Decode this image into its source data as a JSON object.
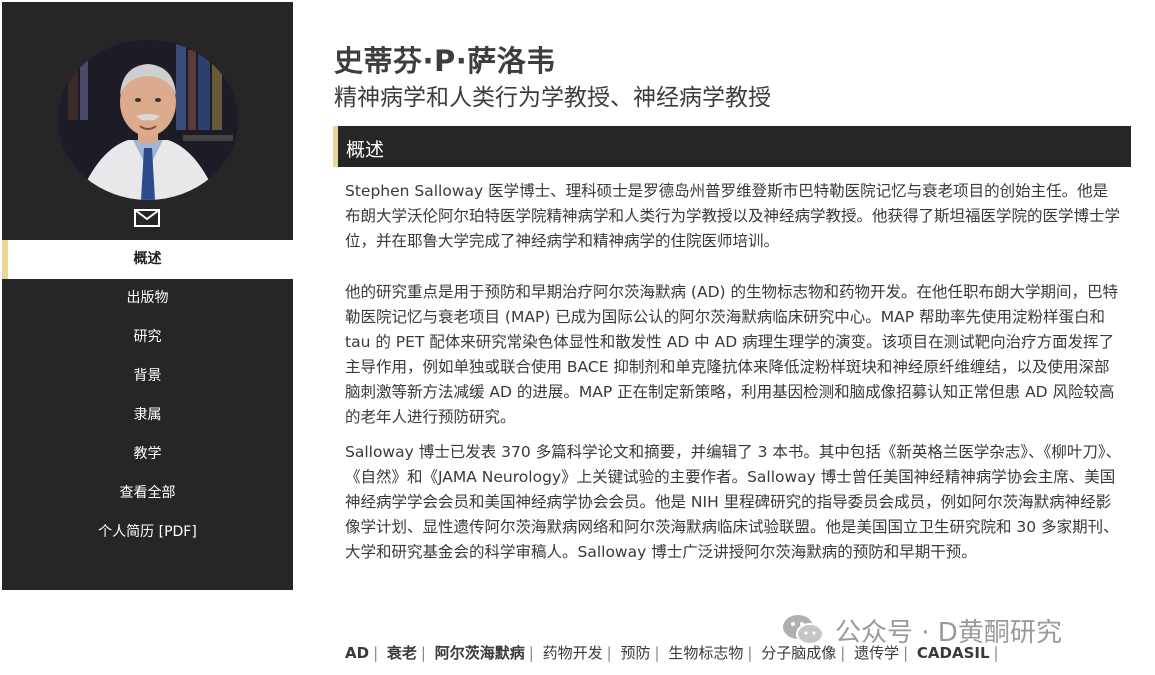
{
  "profile": {
    "name": "史蒂芬·P·萨洛韦",
    "title": "精神病学和人类行为学教授、神经病学教授"
  },
  "sidebar": {
    "items": [
      {
        "label": "概述"
      },
      {
        "label": "出版物"
      },
      {
        "label": "研究"
      },
      {
        "label": "背景"
      },
      {
        "label": "隶属"
      },
      {
        "label": "教学"
      },
      {
        "label": "查看全部"
      },
      {
        "label": "个人简历 [PDF]"
      }
    ]
  },
  "overview": {
    "heading": "概述",
    "paragraphs": [
      "Stephen Salloway 医学博士、理科硕士是罗德岛州普罗维登斯市巴特勒医院记忆与衰老项目的创始主任。他是布朗大学沃伦阿尔珀特医学院精神病学和人类行为学教授以及神经病学教授。他获得了斯坦福医学院的医学博士学位，并在耶鲁大学完成了神经病学和精神病学的住院医师培训。",
      "他的研究重点是用于预防和早期治疗阿尔茨海默病 (AD) 的生物标志物和药物开发。在他任职布朗大学期间，巴特勒医院记忆与衰老项目 (MAP) 已成为国际公认的阿尔茨海默病临床研究中心。MAP 帮助率先使用淀粉样蛋白和 tau 的 PET 配体来研究常染色体显性和散发性 AD 中 AD 病理生理学的演变。该项目在测试靶向治疗方面发挥了主导作用，例如单独或联合使用 BACE 抑制剂和单克隆抗体来降低淀粉样斑块和神经原纤维缠结，以及使用深部脑刺激等新方法减缓 AD 的进展。MAP 正在制定新策略，利用基因检测和脑成像招募认知正常但患 AD 风险较高的老年人进行预防研究。",
      "Salloway 博士已发表 370 多篇科学论文和摘要，并编辑了 3 本书。其中包括《新英格兰医学杂志》、《柳叶刀》、《自然》和《JAMA Neurology》上关键试验的主要作者。Salloway 博士曾任美国神经精神病学协会主席、美国神经病学学会会员和美国神经病学协会会员。他是 NIH 里程碑研究的指导委员会成员，例如阿尔茨海默病神经影像学计划、显性遗传阿尔茨海默病网络和阿尔茨海默病临床试验联盟。他是美国国立卫生研究院和 30 多家期刊、大学和研究基金会的科学审稿人。Salloway 博士广泛讲授阿尔茨海默病的预防和早期干预。"
    ]
  },
  "tags": [
    {
      "label": "AD"
    },
    {
      "label": "衰老"
    },
    {
      "label": "阿尔茨海默病"
    },
    {
      "label": "药物开发"
    },
    {
      "label": "预防"
    },
    {
      "label": "生物标志物"
    },
    {
      "label": "分子脑成像"
    },
    {
      "label": "遗传学"
    },
    {
      "label": "CADASIL"
    }
  ],
  "watermark": {
    "text": "公众号 · D黄酮研究"
  },
  "icons": {
    "email": "envelope-icon",
    "watermark": "wechat-icon"
  },
  "colors": {
    "sidebar_bg": "#262626",
    "accent": "#e8d59a"
  }
}
